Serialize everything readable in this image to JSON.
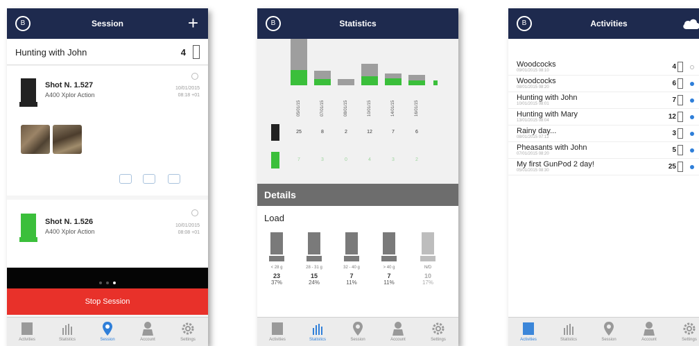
{
  "session_screen": {
    "title": "Session",
    "add_label": "+",
    "activity_name": "Hunting with John",
    "activity_count": "4",
    "shots": [
      {
        "name": "Shot N. 1.527",
        "desc": "A400 Xplor Action",
        "date": "10/01/2015",
        "time": "08:18 +01"
      },
      {
        "name": "Shot N. 1.526",
        "desc": "A400 Xplor Action",
        "date": "10/01/2015",
        "time": "08:08 +01"
      }
    ],
    "stop_label": "Stop Session"
  },
  "statistics_screen": {
    "title": "Statistics",
    "dates": [
      "05/01/15",
      "07/01/15",
      "08/01/15",
      "10/01/15",
      "14/01/15",
      "16/01/15"
    ],
    "gray_counts": [
      "25",
      "8",
      "2",
      "12",
      "7",
      "6"
    ],
    "green_counts": [
      "7",
      "3",
      "0",
      "4",
      "3",
      "2"
    ],
    "details_label": "Details",
    "load_title": "Load",
    "loads": [
      {
        "range": "< 28 g",
        "count": "23",
        "pct": "37%"
      },
      {
        "range": "28 - 31 g",
        "count": "15",
        "pct": "24%"
      },
      {
        "range": "32 - 40 g",
        "count": "7",
        "pct": "11%"
      },
      {
        "range": "> 40 g",
        "count": "7",
        "pct": "11%"
      },
      {
        "range": "N/D",
        "count": "10",
        "pct": "17%"
      }
    ]
  },
  "activities_screen": {
    "title": "Activities",
    "items": [
      {
        "name": "Woodcocks",
        "date": "09/01/2015 08:10",
        "count": "4"
      },
      {
        "name": "Woodcocks",
        "date": "08/01/2015 08:20",
        "count": "6"
      },
      {
        "name": "Hunting with John",
        "date": "10/01/2015 08:01",
        "count": "7"
      },
      {
        "name": "Hunting with Mary",
        "date": "13/01/2015 08:04",
        "count": "12"
      },
      {
        "name": "Rainy day...",
        "date": "08/01/2015 07:12",
        "count": "3"
      },
      {
        "name": "Pheasants with John",
        "date": "07/01/2015 08:20",
        "count": "5"
      },
      {
        "name": "My first GunPod 2 day!",
        "date": "05/01/2015 08:30",
        "count": "25"
      }
    ]
  },
  "tabs": [
    "Activities",
    "Statistics",
    "Session",
    "Account",
    "Settings"
  ],
  "colors": {
    "header": "#1e2a4e",
    "accent": "#2f7fd9",
    "stop": "#e8312a",
    "green": "#3bbf3b",
    "gray": "#9e9e9e"
  }
}
